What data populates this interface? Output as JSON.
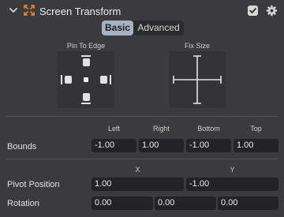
{
  "header": {
    "title": "Screen Transform",
    "enabled": true,
    "accent_color": "#e0843a"
  },
  "tabs": [
    {
      "label": "Basic",
      "active": true
    },
    {
      "label": "Advanced",
      "active": false
    }
  ],
  "pin_to_edge": {
    "label": "Pin To Edge"
  },
  "fix_size": {
    "label": "Fix Size"
  },
  "bounds": {
    "label": "Bounds",
    "columns": [
      "Left",
      "Right",
      "Bottom",
      "Top"
    ],
    "values": [
      "-1.00",
      "1.00",
      "-1.00",
      "1.00"
    ]
  },
  "pivot": {
    "label": "Pivot Position",
    "columns": [
      "X",
      "Y"
    ],
    "values": [
      "1.00",
      "-1.00"
    ]
  },
  "rotation": {
    "label": "Rotation",
    "values": [
      "0.00",
      "0.00",
      "0.00"
    ]
  }
}
